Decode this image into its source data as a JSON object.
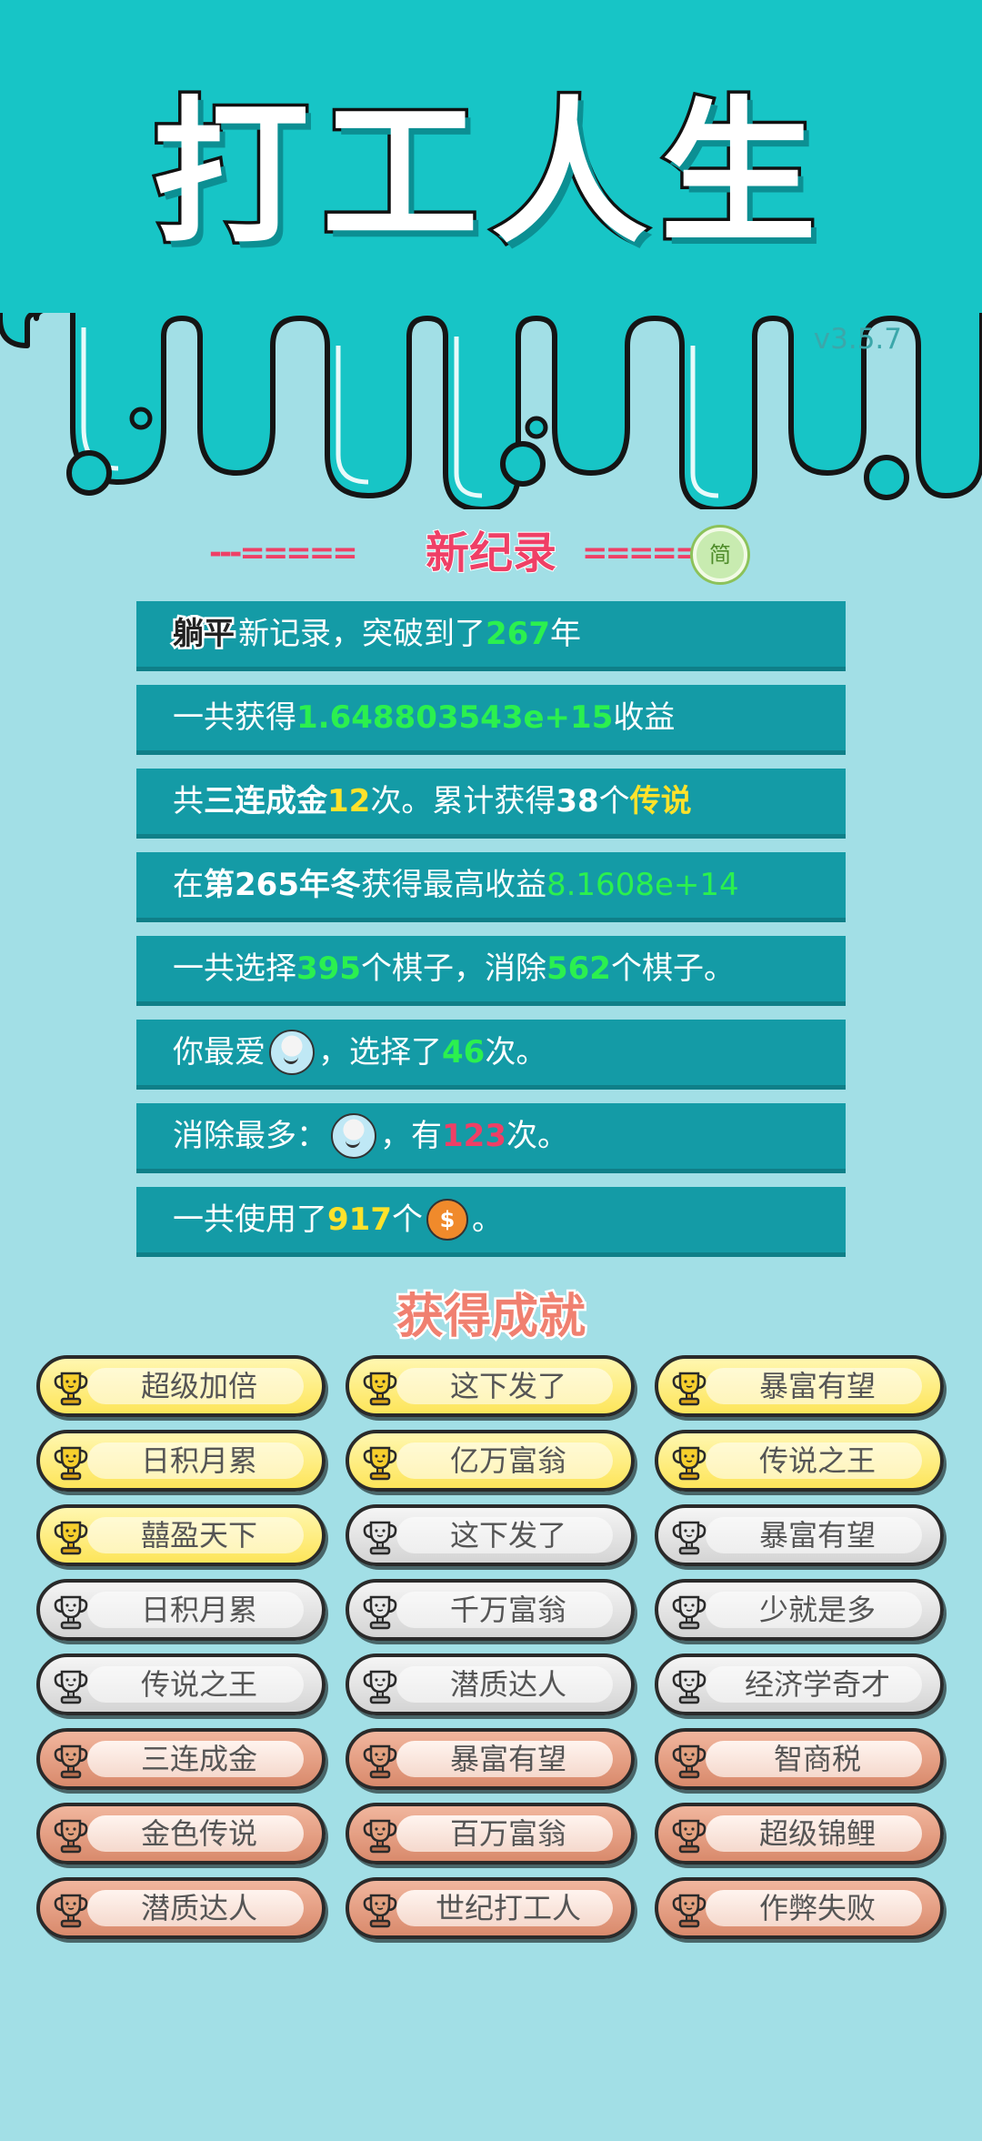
{
  "header": {
    "title": "打工人生",
    "version": "v3.5.7"
  },
  "section": {
    "left_dash": "---=====",
    "title": "新纪录",
    "right_dash": "=====-",
    "lang_toggle": "简"
  },
  "records": {
    "r1": {
      "tag": "躺平",
      "pre": "新记录，突破到了",
      "value": "267",
      "post": "年"
    },
    "r2": {
      "pre": "一共获得",
      "value": "1.648803543e+15",
      "post": "收益"
    },
    "r3": {
      "pre": "共",
      "emph": "三连成金",
      "count": "12",
      "mid": "次。累计获得",
      "count2": "38",
      "mid2": "个",
      "legend": "传说"
    },
    "r4": {
      "pre": "在 ",
      "emph": "第265年冬",
      "mid": " 获得最高收益",
      "value": "8.1608e+14"
    },
    "r5": {
      "pre": "一共选择",
      "v1": "395",
      "mid": "个棋子，消除",
      "v2": "562",
      "post": "个棋子。"
    },
    "r6": {
      "pre": "你最爱",
      "mid": "，选择了",
      "value": "46",
      "post": "次。"
    },
    "r7": {
      "pre": "消除最多：",
      "mid": "，有",
      "value": "123",
      "post": "次。"
    },
    "r8": {
      "pre": "一共使用了",
      "value": "917",
      "mid": "个",
      "post": "。",
      "coin": "$"
    }
  },
  "achievements": {
    "title": "获得成就",
    "items": [
      {
        "label": "超级加倍",
        "tier": "gold"
      },
      {
        "label": "这下发了",
        "tier": "gold"
      },
      {
        "label": "暴富有望",
        "tier": "gold"
      },
      {
        "label": "日积月累",
        "tier": "gold"
      },
      {
        "label": "亿万富翁",
        "tier": "gold"
      },
      {
        "label": "传说之王",
        "tier": "gold"
      },
      {
        "label": "囍盈天下",
        "tier": "gold"
      },
      {
        "label": "这下发了",
        "tier": "silver"
      },
      {
        "label": "暴富有望",
        "tier": "silver"
      },
      {
        "label": "日积月累",
        "tier": "silver"
      },
      {
        "label": "千万富翁",
        "tier": "silver"
      },
      {
        "label": "少就是多",
        "tier": "silver"
      },
      {
        "label": "传说之王",
        "tier": "silver"
      },
      {
        "label": "潜质达人",
        "tier": "silver"
      },
      {
        "label": "经济学奇才",
        "tier": "silver"
      },
      {
        "label": "三连成金",
        "tier": "bronze"
      },
      {
        "label": "暴富有望",
        "tier": "bronze"
      },
      {
        "label": "智商税",
        "tier": "bronze"
      },
      {
        "label": "金色传说",
        "tier": "bronze"
      },
      {
        "label": "百万富翁",
        "tier": "bronze"
      },
      {
        "label": "超级锦鲤",
        "tier": "bronze"
      },
      {
        "label": "潜质达人",
        "tier": "bronze"
      },
      {
        "label": "世纪打工人",
        "tier": "bronze"
      },
      {
        "label": "作弊失败",
        "tier": "bronze"
      }
    ]
  },
  "colors": {
    "header_bg": "#17c5c6",
    "page_bg": "#a2dfe6",
    "row_bg": "#149ba6",
    "gold": "#fde55a",
    "silver": "#d4d4d4",
    "bronze": "#d98a6c",
    "accent_red": "#ef3f66",
    "accent_green": "#2bf04f",
    "accent_yellow": "#ffe22b"
  }
}
